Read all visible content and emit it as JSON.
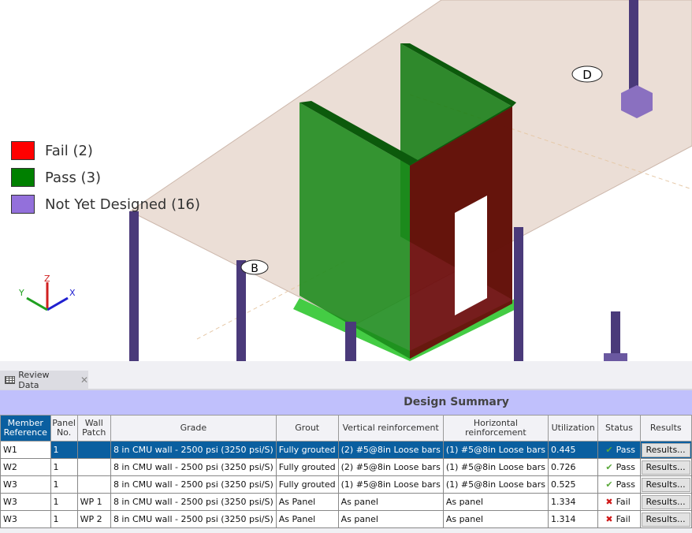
{
  "legend": [
    {
      "label": "Fail (2)",
      "color": "#ff0000"
    },
    {
      "label": "Pass (3)",
      "color": "#008000"
    },
    {
      "label": "Not Yet Designed (16)",
      "color": "#9370db"
    }
  ],
  "axes": {
    "x": "X",
    "y": "Y",
    "z": "Z"
  },
  "grid_labels": {
    "d": "D",
    "b": "B"
  },
  "tab": {
    "label": "Review Data",
    "icon": "table-icon"
  },
  "summary_title": "Design Summary",
  "columns": [
    "Member Reference",
    "Panel No.",
    "Wall Patch",
    "Grade",
    "Grout",
    "Vertical reinforcement",
    "Horizontal reinforcement",
    "Utilization",
    "Status",
    "Results"
  ],
  "rows": [
    {
      "member": "W1",
      "panel": "1",
      "patch": "",
      "grade": "8 in CMU wall - 2500 psi (3250 psi/S)",
      "grout": "Fully grouted",
      "vert": "(2) #5@8in Loose bars",
      "horiz": "(1) #5@8in Loose bars",
      "util": "0.445",
      "status": "Pass",
      "results": "Results..."
    },
    {
      "member": "W2",
      "panel": "1",
      "patch": "",
      "grade": "8 in CMU wall - 2500 psi (3250 psi/S)",
      "grout": "Fully grouted",
      "vert": "(2) #5@8in Loose bars",
      "horiz": "(1) #5@8in Loose bars",
      "util": "0.726",
      "status": "Pass",
      "results": "Results..."
    },
    {
      "member": "W3",
      "panel": "1",
      "patch": "",
      "grade": "8 in CMU wall - 2500 psi (3250 psi/S)",
      "grout": "Fully grouted",
      "vert": "(1) #5@8in Loose bars",
      "horiz": "(1) #5@8in Loose bars",
      "util": "0.525",
      "status": "Pass",
      "results": "Results..."
    },
    {
      "member": "W3",
      "panel": "1",
      "patch": "WP 1",
      "grade": "8 in CMU wall - 2500 psi (3250 psi/S)",
      "grout": "As Panel",
      "vert": "As panel",
      "horiz": "As panel",
      "util": "1.334",
      "status": "Fail",
      "results": "Results..."
    },
    {
      "member": "W3",
      "panel": "1",
      "patch": "WP 2",
      "grade": "8 in CMU wall - 2500 psi (3250 psi/S)",
      "grout": "As Panel",
      "vert": "As panel",
      "horiz": "As panel",
      "util": "1.314",
      "status": "Fail",
      "results": "Results..."
    }
  ]
}
